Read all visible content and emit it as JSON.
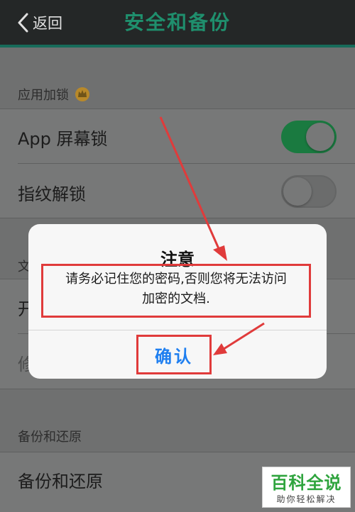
{
  "header": {
    "back_label": "返回",
    "title": "安全和备份"
  },
  "app_lock": {
    "section_label": "应用加锁",
    "rows": [
      {
        "label": "App 屏幕锁",
        "toggle": true
      },
      {
        "label": "指纹解锁",
        "toggle": false
      }
    ]
  },
  "doc_section": {
    "section_label": "文",
    "rows": [
      {
        "label": "开"
      },
      {
        "label": "修"
      }
    ]
  },
  "backup": {
    "section_label": "备份和还原",
    "rows": [
      {
        "label": "备份和还原"
      }
    ]
  },
  "dialog": {
    "title": "注意",
    "message_line1": "请务必记住您的密码,否则您将无法访问",
    "message_line2": "加密的文档.",
    "confirm_label": "确认"
  },
  "watermark": {
    "title": "百科全说",
    "subtitle": "助你轻松解决"
  },
  "colors": {
    "header_bg": "#242727",
    "title_green": "#1f8f6d",
    "toggle_on": "#1a7a40",
    "highlight_red": "#e03b3b",
    "confirm_blue": "#1f7ff0"
  }
}
